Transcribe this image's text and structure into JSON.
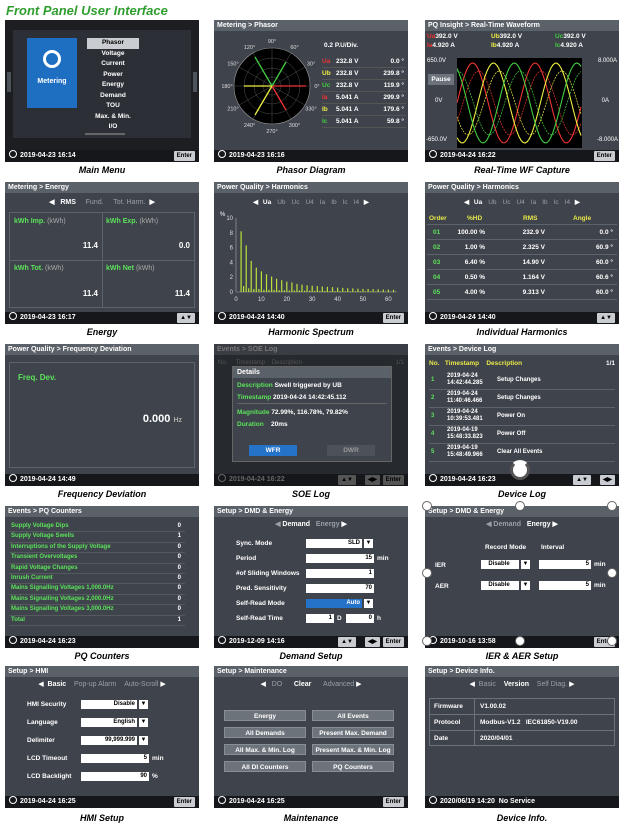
{
  "title": "Front Panel User Interface",
  "caps": [
    "Main Menu",
    "Phasor Diagram",
    "Real-Time WF Capture",
    "Energy",
    "Harmonic Spectrum",
    "Individual Harmonics",
    "Frequency Deviation",
    "SOE Log",
    "Device Log",
    "PQ Counters",
    "Demand Setup",
    "IER & AER Setup",
    "HMI Setup",
    "Maintenance",
    "Device Info."
  ],
  "s1": {
    "app": "Metering",
    "menu": [
      "Phasor",
      "Voltage",
      "Current",
      "Power",
      "Energy",
      "Demand",
      "TOU",
      "Max. & Min.",
      "I/O"
    ],
    "time": "2019-04-23 16:14",
    "btn": "Enter"
  },
  "s2": {
    "hdr": "Metering > Phasor",
    "scale": "0.2 P.U/Div.",
    "angles": [
      "90°",
      "60°",
      "30°",
      "0°",
      "330°",
      "300°",
      "270°",
      "240°",
      "210°",
      "180°",
      "150°",
      "120°"
    ],
    "rows": [
      {
        "n": "Ua",
        "v": "232.8 V",
        "a": "0.0 °"
      },
      {
        "n": "Ub",
        "v": "232.8 V",
        "a": "239.8 °"
      },
      {
        "n": "Uc",
        "v": "232.8 V",
        "a": "119.9 °"
      },
      {
        "n": "Ia",
        "v": "5.041 A",
        "a": "299.9 °"
      },
      {
        "n": "Ib",
        "v": "5.041 A",
        "a": "179.6 °"
      },
      {
        "n": "Ic",
        "v": "5.041 A",
        "a": "59.8 °"
      }
    ],
    "time": "2019-04-23 16:16"
  },
  "s3": {
    "hdr": "PQ Insight > Real-Time Waveform",
    "legend": [
      [
        "Ua",
        "392.0 V"
      ],
      [
        "Ub",
        "392.0 V"
      ],
      [
        "Uc",
        "392.0 V"
      ],
      [
        "Ia",
        "4.920 A"
      ],
      [
        "Ib",
        "4.920 A"
      ],
      [
        "Ic",
        "4.920 A"
      ]
    ],
    "yl": [
      "650.0V",
      "0V",
      "-650.0V"
    ],
    "yr": [
      "8.000A",
      "0A",
      "-8.000A"
    ],
    "pause": "Pause",
    "time": "2019-04-24 16:22",
    "btn": "Enter"
  },
  "s4": {
    "hdr": "Metering > Energy",
    "tabs": [
      "RMS",
      "Fund.",
      "Tot. Harm."
    ],
    "cells": [
      {
        "l": "kWh Imp.",
        "u": "(kWh)",
        "v": "11.4"
      },
      {
        "l": "kWh Exp.",
        "u": "(kWh)",
        "v": "0.0"
      },
      {
        "l": "kWh Tot.",
        "u": "(kWh)",
        "v": "11.4"
      },
      {
        "l": "kWh Net",
        "u": "(kWh)",
        "v": "11.4"
      }
    ],
    "time": "2019-04-23 16:17"
  },
  "s5": {
    "hdr": "Power Quality > Harmonics",
    "tabs": [
      "Ua",
      "Ub",
      "Uc",
      "U4",
      "Ia",
      "Ib",
      "Ic",
      "I4"
    ],
    "yunit": "%",
    "yticks": [
      "10",
      "8",
      "6",
      "4",
      "2",
      "0"
    ],
    "xticks": [
      "0",
      "10",
      "20",
      "30",
      "40",
      "50",
      "60"
    ],
    "time": "2019-04-24 14:40",
    "btn": "Enter"
  },
  "chart_data": {
    "type": "bar",
    "ylim": [
      0,
      10
    ],
    "xlim": [
      0,
      63
    ],
    "ylabel": "%",
    "values": [
      8.2,
      0.8,
      6.3,
      0.5,
      4.2,
      0.4,
      3.3,
      0.4,
      2.8,
      0.3,
      2.4,
      0.3,
      2.1,
      0.3,
      1.8,
      0.25,
      1.6,
      0.25,
      1.4,
      0.2,
      1.3,
      0.2,
      1.1,
      0.2,
      1.0,
      0.18,
      0.9,
      0.18,
      0.85,
      0.15,
      0.8,
      0.15,
      0.75,
      0.15,
      0.7,
      0.12,
      0.65,
      0.12,
      0.6,
      0.12,
      0.55,
      0.1,
      0.5,
      0.1,
      0.48,
      0.1,
      0.45,
      0.1,
      0.42,
      0.08,
      0.4,
      0.08,
      0.38,
      0.08,
      0.36,
      0.06,
      0.34,
      0.06,
      0.32,
      0.06,
      0.3,
      0.05
    ]
  },
  "s6": {
    "hdr": "Power Quality > Harmonics",
    "tabs": [
      "Ua",
      "Ub",
      "Uc",
      "U4",
      "Ia",
      "Ib",
      "Ic",
      "I4"
    ],
    "cols": [
      "Order",
      "%HD",
      "RMS",
      "Angle"
    ],
    "rows": [
      [
        "01",
        "100.00 %",
        "232.9 V",
        "0.0 °"
      ],
      [
        "02",
        "1.00 %",
        "2.325 V",
        "60.9 °"
      ],
      [
        "03",
        "6.40 %",
        "14.90 V",
        "60.0 °"
      ],
      [
        "04",
        "0.50 %",
        "1.164 V",
        "60.6 °"
      ],
      [
        "05",
        "4.00 %",
        "9.313 V",
        "60.0 °"
      ]
    ],
    "time": "2019-04-24 14:40"
  },
  "s7": {
    "hdr": "Power Quality > Frequency Deviation",
    "label": "Freq. Dev.",
    "value": "0.000",
    "unit": "Hz",
    "time": "2019-04-24 14:49"
  },
  "s8": {
    "hdr": "Events > SOE Log",
    "cols": [
      "No.",
      "Timestamp",
      "Description"
    ],
    "page": "1/1",
    "dlg": "Details",
    "desc_l": "Description",
    "desc": "Swell triggered by UB",
    "ts_l": "Timestamp",
    "ts": "2019-04-24 14:42:45.112",
    "mag_l": "Magnitude",
    "mag": "72.99%, 116.78%, 79.82%",
    "dur_l": "Duration",
    "dur": "20ms",
    "b1": "WFR",
    "b2": "DWR",
    "time": "2019-04-24 16:22",
    "btn": "Enter"
  },
  "s9": {
    "hdr": "Events > Device Log",
    "cols": [
      "No.",
      "Timestamp",
      "Description"
    ],
    "page": "1/1",
    "rows": [
      [
        "1",
        "2019-04-24 14:42:44.285",
        "Setup Changes"
      ],
      [
        "2",
        "2019-04-24 11:40:46.466",
        "Setup Changes"
      ],
      [
        "3",
        "2019-04-24 10:39:53.481",
        "Power On"
      ],
      [
        "4",
        "2019-04-19 15:48:33.823",
        "Power Off"
      ],
      [
        "5",
        "2019-04-19 15:48:49.966",
        "Clear All Events"
      ]
    ],
    "time": "2019-04-24 16:23"
  },
  "s10": {
    "hdr": "Events > PQ Counters",
    "rows": [
      [
        "Supply Voltage Dips",
        "0"
      ],
      [
        "Supply Voltage Swells",
        "1"
      ],
      [
        "Interruptions of the Supply Voltage",
        "0"
      ],
      [
        "Transient Overvoltages",
        "0"
      ],
      [
        "Rapid Voltage Changes",
        "0"
      ],
      [
        "Inrush Current",
        "0"
      ],
      [
        "Mains Signalling Voltages 1,000.0Hz",
        "0"
      ],
      [
        "Mains Signalling Voltages 2,000.0Hz",
        "0"
      ],
      [
        "Mains Signalling Voltages 3,000.0Hz",
        "0"
      ],
      [
        "Total",
        "1"
      ]
    ],
    "time": "2019-04-24 16:23"
  },
  "s11": {
    "hdr": "Setup > DMD & Energy",
    "tabs": [
      "Demand",
      "Energy"
    ],
    "sync_l": "Sync. Mode",
    "sync": "SLD",
    "period_l": "Period",
    "period": "15",
    "min": "min",
    "win_l": "#of Sliding Windows",
    "win": "1",
    "sens_l": "Pred. Sensitivity",
    "sens": "70",
    "srm_l": "Self-Read Mode",
    "srm": "Auto",
    "srt_l": "Self-Read Time",
    "srt_d": "1",
    "d": "D",
    "srt_h": "0",
    "h": "h",
    "time": "2019-12-09 14:16",
    "btn": "Enter"
  },
  "s12": {
    "hdr": "Setup > DMD & Energy",
    "tabs": [
      "Demand",
      "Energy"
    ],
    "c1": "Record Mode",
    "c2": "Interval",
    "r1": "IER",
    "r2": "AER",
    "m1": "Disable",
    "m2": "Disable",
    "i1": "5",
    "i2": "5",
    "min": "min",
    "time": "2019-10-16 13:58",
    "btn": "Enter"
  },
  "s13": {
    "hdr": "Setup > HMI",
    "tabs": [
      "Basic",
      "Pop-up Alarm",
      "Auto-Scroll"
    ],
    "rows": [
      [
        "HMI Security",
        "Disable",
        ""
      ],
      [
        "Language",
        "English",
        ""
      ],
      [
        "Delimiter",
        "99,999.999",
        ""
      ],
      [
        "LCD Timeout",
        "5",
        "min"
      ],
      [
        "LCD Backlight",
        "90",
        "%"
      ]
    ],
    "time": "2019-04-24 16:25",
    "btn": "Enter"
  },
  "s14": {
    "hdr": "Setup > Maintenance",
    "tabs": [
      "DO",
      "Clear",
      "Advanced"
    ],
    "btns": [
      "Energy",
      "All Events",
      "All Demands",
      "Present Max. Demand",
      "All Max. & Min. Log",
      "Present Max. & Min. Log",
      "All DI Counters",
      "PQ Counters"
    ],
    "time": "2019-04-24 16:25",
    "btn": "Enter"
  },
  "s15": {
    "hdr": "Setup > Device Info.",
    "tabs": [
      "Basic",
      "Version",
      "Self Diag."
    ],
    "rows": [
      [
        "Firmware",
        "V1.00.02"
      ],
      [
        "Protocol",
        "Modbus-V1.2   IEC61850-V19.00"
      ],
      [
        "Date",
        "2020/04/01"
      ]
    ],
    "time": "2020/06/19 14:20",
    "status": "No Service"
  }
}
